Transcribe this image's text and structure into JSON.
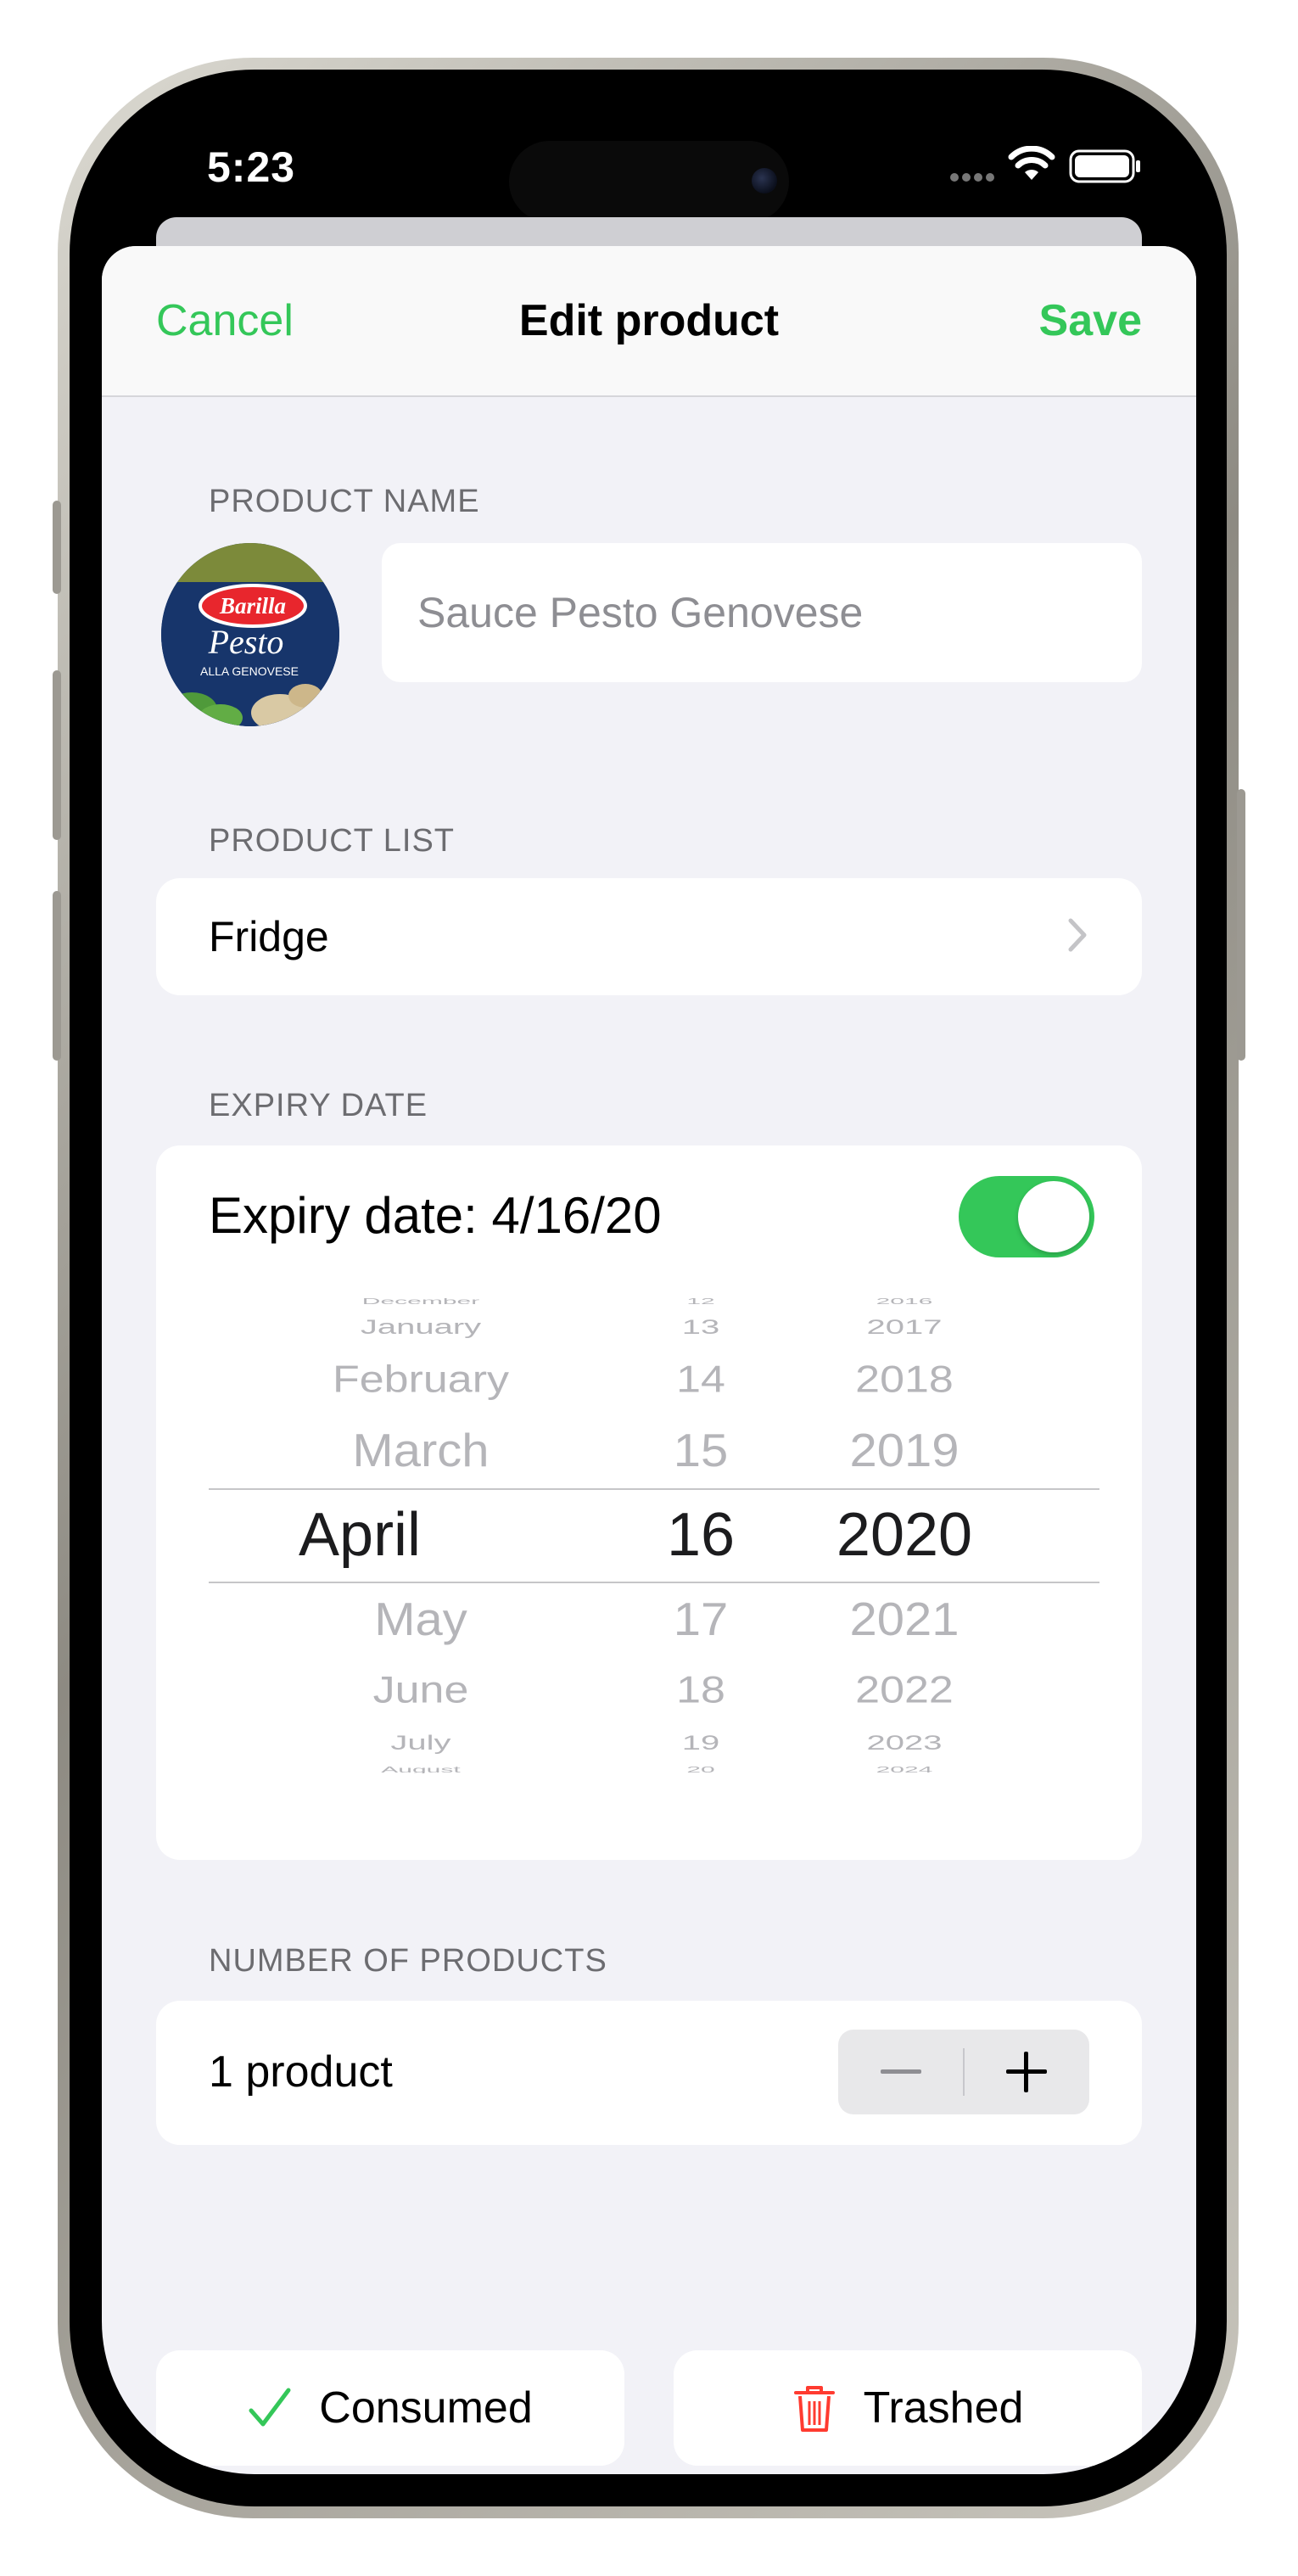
{
  "status_bar": {
    "time": "5:23"
  },
  "nav": {
    "cancel": "Cancel",
    "title": "Edit product",
    "save": "Save"
  },
  "sections": {
    "product_name": "PRODUCT NAME",
    "product_list": "PRODUCT LIST",
    "expiry_date": "EXPIRY DATE",
    "number_of_products": "NUMBER OF PRODUCTS"
  },
  "product": {
    "image_brand": "Barilla",
    "image_title": "Pesto",
    "image_subtitle": "ALLA GENOVESE",
    "name_placeholder": "Sauce Pesto Genovese"
  },
  "product_list": {
    "value": "Fridge"
  },
  "expiry": {
    "label": "Expiry date: 4/16/20",
    "enabled": true,
    "picker": {
      "months": [
        "December",
        "January",
        "February",
        "March",
        "April",
        "May",
        "June",
        "July",
        "August"
      ],
      "days": [
        "12",
        "13",
        "14",
        "15",
        "16",
        "17",
        "18",
        "19",
        "20"
      ],
      "years": [
        "2016",
        "2017",
        "2018",
        "2019",
        "2020",
        "2021",
        "2022",
        "2023",
        "2024"
      ],
      "selected": {
        "month": "April",
        "day": "16",
        "year": "2020"
      }
    }
  },
  "count": {
    "label": "1 product",
    "minus": "−",
    "plus": "+"
  },
  "actions": {
    "consumed": "Consumed",
    "trashed": "Trashed"
  },
  "colors": {
    "accent": "#34c759",
    "trash": "#ff3b30",
    "background": "#f2f2f7"
  }
}
